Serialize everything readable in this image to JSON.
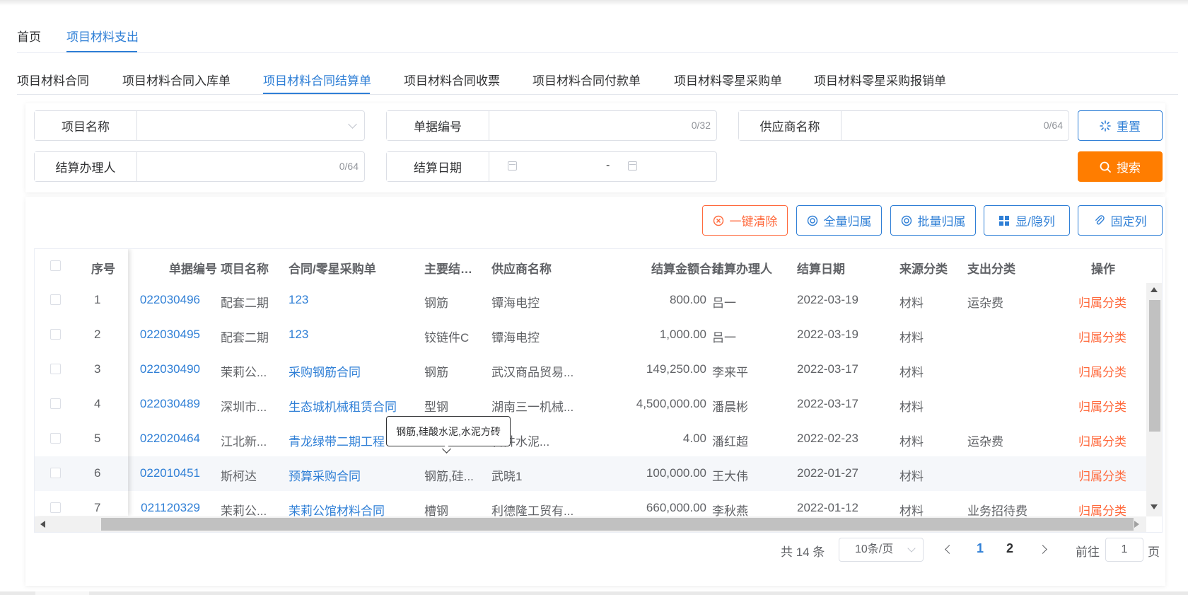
{
  "breadcrumb": {
    "items": [
      "首页",
      "项目材料支出"
    ],
    "active_index": 1
  },
  "sub_tabs": {
    "items": [
      "项目材料合同",
      "项目材料合同入库单",
      "项目材料合同结算单",
      "项目材料合同收票",
      "项目材料合同付款单",
      "项目材料零星采购单",
      "项目材料零星采购报销单"
    ],
    "active_index": 2
  },
  "filters": {
    "project_name": {
      "label": "项目名称",
      "value": ""
    },
    "doc_no": {
      "label": "单据编号",
      "count": "0/32"
    },
    "supplier_name": {
      "label": "供应商名称",
      "count": "0/64"
    },
    "handler": {
      "label": "结算办理人",
      "count": "0/64"
    },
    "settle_date": {
      "label": "结算日期",
      "separator": "-"
    }
  },
  "buttons": {
    "reset": "重置",
    "search": "搜索",
    "clear_all": "一键清除",
    "assign_all": "全量归属",
    "assign_batch": "批量归属",
    "toggle_columns": "显/隐列",
    "pin_columns": "固定列"
  },
  "colors": {
    "primary": "#2f7fd6",
    "warning": "#ff7d00",
    "danger_text": "#ff6a3d"
  },
  "table": {
    "headers": {
      "index": "序号",
      "doc_no": "单据编号",
      "project": "项目名称",
      "contract": "合同/零星采购单",
      "material": "主要结…",
      "supplier": "供应商名称",
      "amount": "结算金额合计",
      "handler": "结算办理人",
      "date": "结算日期",
      "source": "来源分类",
      "expense": "支出分类",
      "action": "操作"
    },
    "rows": [
      {
        "index": "1",
        "doc_no": "022030496",
        "project": "配套二期",
        "contract": "123",
        "material": "钢筋",
        "supplier": "镡海电控",
        "amount": "800.00",
        "handler": "吕一",
        "date": "2022-03-19",
        "source": "材料",
        "expense": "运杂费",
        "action": "归属分类"
      },
      {
        "index": "2",
        "doc_no": "022030495",
        "project": "配套二期",
        "contract": "123",
        "material": "铰链件C",
        "supplier": "镡海电控",
        "amount": "1,000.00",
        "handler": "吕一",
        "date": "2022-03-19",
        "source": "材料",
        "expense": "",
        "action": "归属分类"
      },
      {
        "index": "3",
        "doc_no": "022030490",
        "project": "茉莉公...",
        "contract": "采购钢筋合同",
        "material": "钢筋",
        "supplier": "武汉商品贸易...",
        "amount": "149,250.00",
        "handler": "李来平",
        "date": "2022-03-17",
        "source": "材料",
        "expense": "",
        "action": "归属分类"
      },
      {
        "index": "4",
        "doc_no": "022030489",
        "project": "深圳市...",
        "contract": "生态城机械租赁合同",
        "material": "型钢",
        "supplier": "湖南三一机械...",
        "amount": "4,500,000.00",
        "handler": "潘晨彬",
        "date": "2022-03-17",
        "source": "材料",
        "expense": "",
        "action": "归属分类"
      },
      {
        "index": "5",
        "doc_no": "022020464",
        "project": "江北新...",
        "contract": "青龙绿带二期工程",
        "material": "",
        "supplier": "管井水泥...",
        "amount": "4.00",
        "handler": "潘红超",
        "date": "2022-02-23",
        "source": "材料",
        "expense": "运杂费",
        "action": "归属分类"
      },
      {
        "index": "6",
        "doc_no": "022010451",
        "project": "斯柯达",
        "contract": "预算采购合同",
        "material": "钢筋,硅...",
        "supplier": "武晓1",
        "amount": "100,000.00",
        "handler": "王大伟",
        "date": "2022-01-27",
        "source": "材料",
        "expense": "",
        "action": "归属分类"
      },
      {
        "index": "7",
        "doc_no": "021120329",
        "project": "茉莉公...",
        "contract": "茉莉公馆材料合同",
        "material": "槽钢",
        "supplier": "利德隆工贸有...",
        "amount": "660,000.00",
        "handler": "李秋燕",
        "date": "2022-01-12",
        "source": "材料",
        "expense": "业务招待费",
        "action": "归属分类"
      }
    ]
  },
  "tooltip": {
    "text": "钢筋,硅酸水泥,水泥方砖"
  },
  "pagination": {
    "total_text": "共 14 条",
    "page_size": "10条/页",
    "pages": [
      "1",
      "2"
    ],
    "current_page": "1",
    "goto_label": "前往",
    "goto_value": "1",
    "goto_suffix": "页"
  }
}
